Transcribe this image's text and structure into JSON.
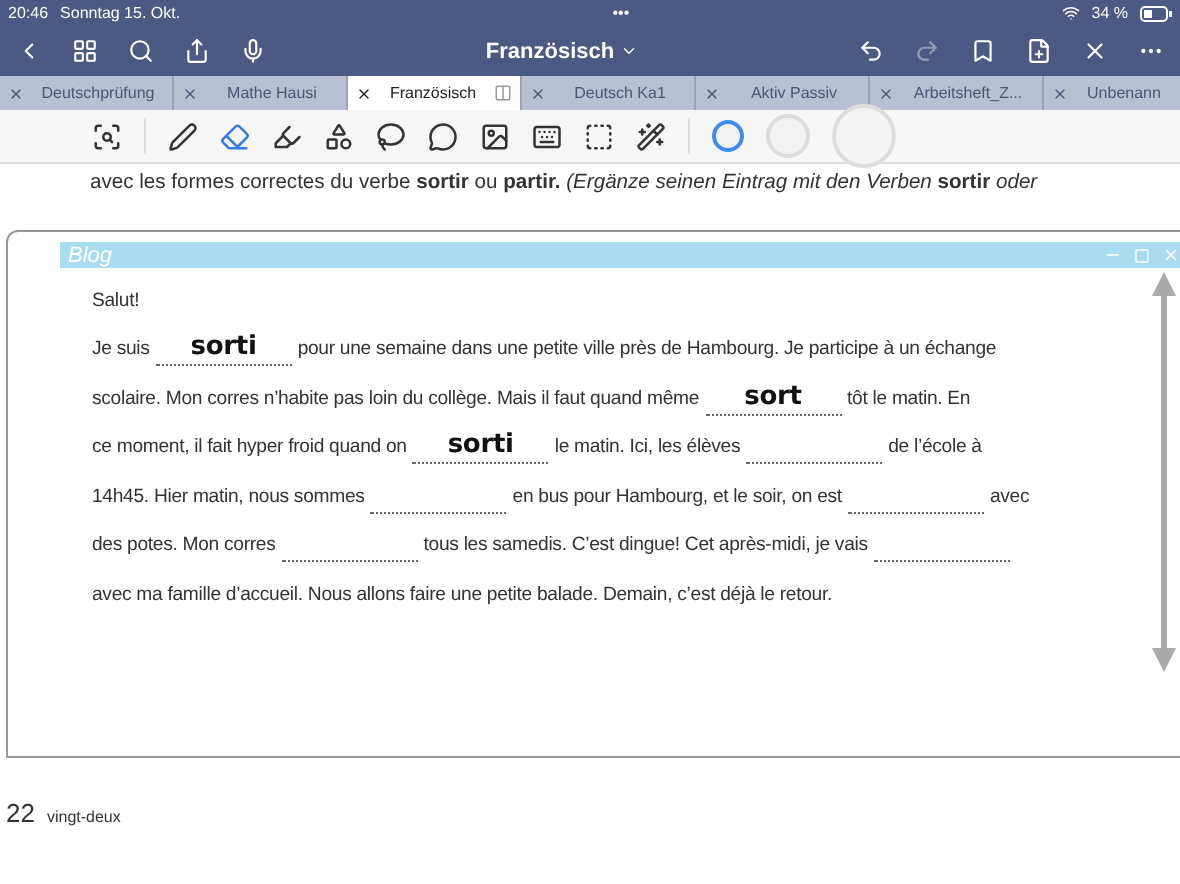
{
  "status_bar": {
    "time": "20:46",
    "date": "Sonntag 15. Okt.",
    "dots": "•••",
    "battery": "34 %"
  },
  "nav_bar": {
    "title": "Französisch",
    "redo": {
      "disabled": true
    }
  },
  "tabs": [
    {
      "label": "Deutschprüfung",
      "selected": false
    },
    {
      "label": "Mathe Hausi",
      "selected": false
    },
    {
      "label": "Französisch",
      "selected": true
    },
    {
      "label": "Deutsch Ka1",
      "selected": false
    },
    {
      "label": "Aktiv Passiv",
      "selected": false
    },
    {
      "label": "Arbeitsheft_Z...",
      "selected": false
    },
    {
      "label": "Unbenann",
      "selected": false
    }
  ],
  "toolbar": {
    "tools": [
      {
        "kind": "scan",
        "selected": false
      },
      {
        "kind": "pen",
        "selected": false
      },
      {
        "kind": "eraser",
        "selected": true
      },
      {
        "kind": "highlighter",
        "selected": false
      },
      {
        "kind": "shapes",
        "selected": false
      },
      {
        "kind": "lasso",
        "selected": false
      },
      {
        "kind": "sticker",
        "selected": false
      },
      {
        "kind": "image",
        "selected": false
      },
      {
        "kind": "keyboard",
        "selected": false
      },
      {
        "kind": "text",
        "selected": false
      },
      {
        "kind": "laser",
        "selected": false
      }
    ],
    "pens": [
      {
        "selected": true
      },
      {
        "selected": false
      },
      {
        "selected": false
      }
    ]
  },
  "page": {
    "instruction": "avec les formes correctes du verbe **sortir** ou **partir.** *(Ergänze seinen Eintrag mit den Verben* **sortir** *oder*",
    "blog": {
      "title": "Blog",
      "greeting": "Salut!",
      "lines": [
        [
          {
            "kind": "text",
            "text": "Je suis"
          },
          {
            "kind": "blank",
            "answer": "sorti"
          },
          {
            "kind": "text",
            "text": "pour une semaine dans une petite ville près de Hambourg. Je participe à un échange"
          }
        ],
        [
          {
            "kind": "text",
            "text": "scolaire. Mon corres n’habite pas loin du collège. Mais il faut quand même"
          },
          {
            "kind": "blank",
            "answer": "sort"
          },
          {
            "kind": "text",
            "text": "tôt le matin. En"
          }
        ],
        [
          {
            "kind": "text",
            "text": "ce moment, il fait hyper froid quand on"
          },
          {
            "kind": "blank",
            "answer": "sorti"
          },
          {
            "kind": "text",
            "text": "le matin. Ici, les élèves"
          },
          {
            "kind": "blank"
          },
          {
            "kind": "text",
            "text": "de l’école à"
          }
        ],
        [
          {
            "kind": "text",
            "text": "14h45. Hier matin, nous sommes"
          },
          {
            "kind": "blank"
          },
          {
            "kind": "text",
            "text": "en bus pour Hambourg, et le soir, on est"
          },
          {
            "kind": "blank"
          },
          {
            "kind": "text",
            "text": "avec"
          }
        ],
        [
          {
            "kind": "text",
            "text": "des potes. Mon corres"
          },
          {
            "kind": "blank"
          },
          {
            "kind": "text",
            "text": "tous les samedis. C’est dingue! Cet après-midi, je vais"
          },
          {
            "kind": "blank"
          }
        ],
        [
          {
            "kind": "text",
            "text": "avec ma famille d’accueil. Nous allons faire une petite balade. Demain, c’est déjà le retour."
          }
        ]
      ]
    },
    "page_number": "22",
    "page_word": "vingt-deux"
  }
}
